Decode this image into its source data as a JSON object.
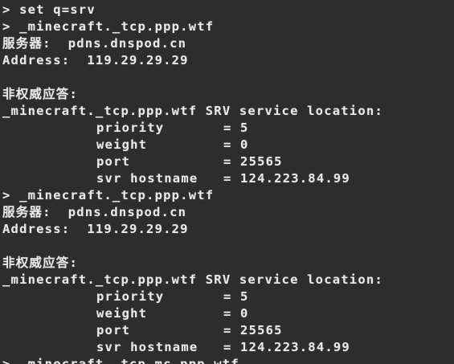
{
  "terminal": {
    "lines": [
      {
        "text": "> set q=srv",
        "indent": false
      },
      {
        "text": "> _minecraft._tcp.ppp.wtf",
        "indent": false
      },
      {
        "text": "服务器:  pdns.dnspod.cn",
        "indent": false
      },
      {
        "text": "Address:  119.29.29.29",
        "indent": false
      },
      {
        "text": "",
        "indent": false
      },
      {
        "text": "非权威应答:",
        "indent": false
      },
      {
        "text": "_minecraft._tcp.ppp.wtf SRV service location:",
        "indent": false
      },
      {
        "text": "priority       = 5",
        "indent": true
      },
      {
        "text": "weight         = 0",
        "indent": true
      },
      {
        "text": "port           = 25565",
        "indent": true
      },
      {
        "text": "svr hostname   = 124.223.84.99",
        "indent": true
      },
      {
        "text": "> _minecraft._tcp.ppp.wtf",
        "indent": false
      },
      {
        "text": "服务器:  pdns.dnspod.cn",
        "indent": false
      },
      {
        "text": "Address:  119.29.29.29",
        "indent": false
      },
      {
        "text": "",
        "indent": false
      },
      {
        "text": "非权威应答:",
        "indent": false
      },
      {
        "text": "_minecraft._tcp.ppp.wtf SRV service location:",
        "indent": false
      },
      {
        "text": "priority       = 5",
        "indent": true
      },
      {
        "text": "weight         = 0",
        "indent": true
      },
      {
        "text": "port           = 25565",
        "indent": true
      },
      {
        "text": "svr hostname   = 124.223.84.99",
        "indent": true
      },
      {
        "text": "> _minecraft._tcp.mc.ppp.wtf",
        "indent": false
      }
    ]
  }
}
